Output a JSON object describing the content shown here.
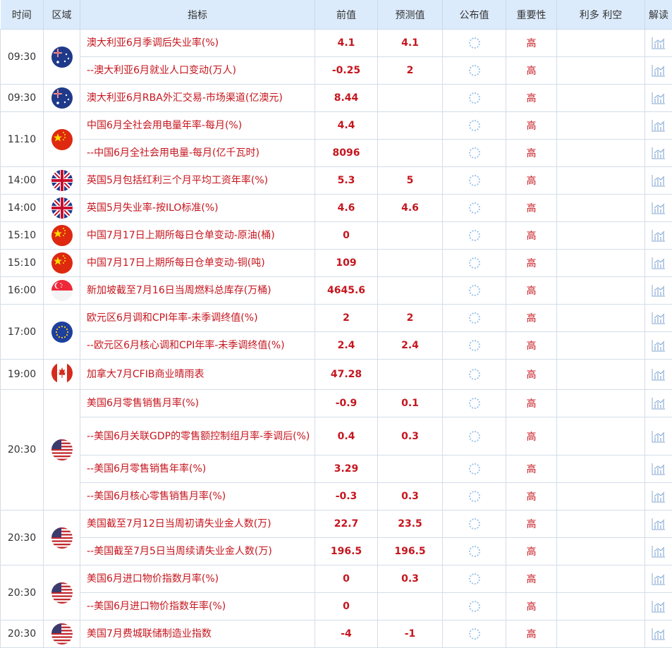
{
  "headers": {
    "time": "时间",
    "region": "区域",
    "indicator": "指标",
    "previous": "前值",
    "forecast": "预测值",
    "actual": "公布值",
    "importance": "重要性",
    "impact": "利多 利空",
    "analysis": "解读"
  },
  "rows": [
    {
      "time": "09:30",
      "flag": "australia-flag",
      "indicator": "澳大利亚6月季调后失业率(%)",
      "previous": "4.1",
      "forecast": "4.1",
      "importance": "高"
    },
    {
      "indicator": "--澳大利亚6月就业人口变动(万人)",
      "previous": "-0.25",
      "forecast": "2",
      "importance": "高"
    },
    {
      "time": "09:30",
      "flag": "australia-flag",
      "indicator": "澳大利亚6月RBA外汇交易-市场渠道(亿澳元)",
      "previous": "8.44",
      "forecast": "",
      "importance": "高"
    },
    {
      "time": "11:10",
      "flag": "china-flag",
      "indicator": "中国6月全社会用电量年率-每月(%)",
      "previous": "4.4",
      "forecast": "",
      "importance": "高"
    },
    {
      "indicator": "--中国6月全社会用电量-每月(亿千瓦时)",
      "previous": "8096",
      "forecast": "",
      "importance": "高"
    },
    {
      "time": "14:00",
      "flag": "uk-flag",
      "indicator": "英国5月包括红利三个月平均工资年率(%)",
      "previous": "5.3",
      "forecast": "5",
      "importance": "高"
    },
    {
      "time": "14:00",
      "flag": "uk-flag",
      "indicator": "英国5月失业率-按ILO标准(%)",
      "previous": "4.6",
      "forecast": "4.6",
      "importance": "高"
    },
    {
      "time": "15:10",
      "flag": "china-flag",
      "indicator": "中国7月17日上期所每日仓单变动-原油(桶)",
      "previous": "0",
      "forecast": "",
      "importance": "高"
    },
    {
      "time": "15:10",
      "flag": "china-flag",
      "indicator": "中国7月17日上期所每日仓单变动-铜(吨)",
      "previous": "109",
      "forecast": "",
      "importance": "高"
    },
    {
      "time": "16:00",
      "flag": "singapore-flag",
      "indicator": "新加坡截至7月16日当周燃料总库存(万桶)",
      "previous": "4645.6",
      "forecast": "",
      "importance": "高"
    },
    {
      "time": "17:00",
      "flag": "eu-flag",
      "indicator": "欧元区6月调和CPI年率-未季调终值(%)",
      "previous": "2",
      "forecast": "2",
      "importance": "高"
    },
    {
      "indicator": "--欧元区6月核心调和CPI年率-未季调终值(%)",
      "previous": "2.4",
      "forecast": "2.4",
      "importance": "高"
    },
    {
      "time": "19:00",
      "flag": "canada-flag",
      "indicator": "加拿大7月CFIB商业晴雨表",
      "previous": "47.28",
      "forecast": "",
      "importance": "高"
    },
    {
      "time": "20:30",
      "flag": "us-flag",
      "indicator": "美国6月零售销售月率(%)",
      "previous": "-0.9",
      "forecast": "0.1",
      "importance": "高"
    },
    {
      "indicator": "--美国6月关联GDP的零售额控制组月率-季调后(%)",
      "previous": "0.4",
      "forecast": "0.3",
      "importance": "高"
    },
    {
      "indicator": "--美国6月零售销售年率(%)",
      "previous": "3.29",
      "forecast": "",
      "importance": "高"
    },
    {
      "indicator": "--美国6月核心零售销售月率(%)",
      "previous": "-0.3",
      "forecast": "0.3",
      "importance": "高"
    },
    {
      "time": "20:30",
      "flag": "us-flag",
      "indicator": "美国截至7月12日当周初请失业金人数(万)",
      "previous": "22.7",
      "forecast": "23.5",
      "importance": "高"
    },
    {
      "indicator": "--美国截至7月5日当周续请失业金人数(万)",
      "previous": "196.5",
      "forecast": "196.5",
      "importance": "高"
    },
    {
      "time": "20:30",
      "flag": "us-flag",
      "indicator": "美国6月进口物价指数月率(%)",
      "previous": "0",
      "forecast": "0.3",
      "importance": "高"
    },
    {
      "indicator": "--美国6月进口物价指数年率(%)",
      "previous": "0",
      "forecast": "",
      "importance": "高"
    },
    {
      "time": "20:30",
      "flag": "us-flag",
      "indicator": "美国7月费城联储制造业指数",
      "previous": "-4",
      "forecast": "-1",
      "importance": "高"
    }
  ]
}
